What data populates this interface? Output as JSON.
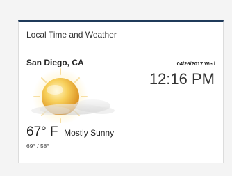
{
  "widget": {
    "title": "Local Time and Weather",
    "location": "San Diego, CA",
    "date": "04/26/2017",
    "weekday": "Wed",
    "date_line": "04/26/2017  Wed",
    "time": "12:16 PM",
    "temperature": "67° F",
    "condition": "Mostly Sunny",
    "high_low": "69° / 58°",
    "icon": "partly-sunny-icon",
    "colors": {
      "accent": "#1f3a5a",
      "sun": "#f0b63a",
      "background": "#f4f4f4"
    }
  }
}
